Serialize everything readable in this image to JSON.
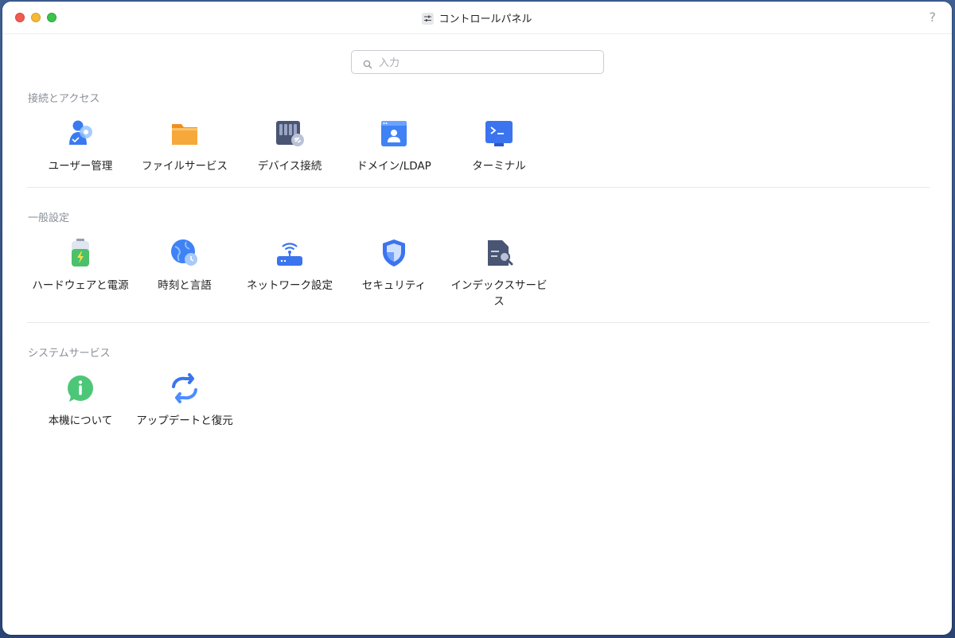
{
  "window": {
    "title": "コントロールパネル",
    "help_label": "?"
  },
  "search": {
    "placeholder": "入力",
    "value": ""
  },
  "sections": [
    {
      "title": "接続とアクセス",
      "items": [
        {
          "label": "ユーザー管理",
          "icon": "user-management-icon"
        },
        {
          "label": "ファイルサービス",
          "icon": "folder-icon"
        },
        {
          "label": "デバイス接続",
          "icon": "nas-device-link-icon"
        },
        {
          "label": "ドメイン/LDAP",
          "icon": "domain-ldap-icon"
        },
        {
          "label": "ターミナル",
          "icon": "terminal-icon"
        }
      ]
    },
    {
      "title": "一般設定",
      "items": [
        {
          "label": "ハードウェアと電源",
          "icon": "battery-icon"
        },
        {
          "label": "時刻と言語",
          "icon": "globe-clock-icon"
        },
        {
          "label": "ネットワーク設定",
          "icon": "router-wifi-icon"
        },
        {
          "label": "セキュリティ",
          "icon": "shield-icon"
        },
        {
          "label": "インデックスサービス",
          "icon": "index-search-icon"
        }
      ]
    },
    {
      "title": "システムサービス",
      "items": [
        {
          "label": "本機について",
          "icon": "info-icon"
        },
        {
          "label": "アップデートと復元",
          "icon": "update-restore-icon"
        }
      ]
    }
  ],
  "colors": {
    "close": "#ee5d52",
    "minimize": "#f5b93a",
    "maximize": "#3cc24d",
    "accent_blue": "#3b7cf6",
    "folder_orange": "#f7a33b",
    "info_green": "#4cc777"
  }
}
